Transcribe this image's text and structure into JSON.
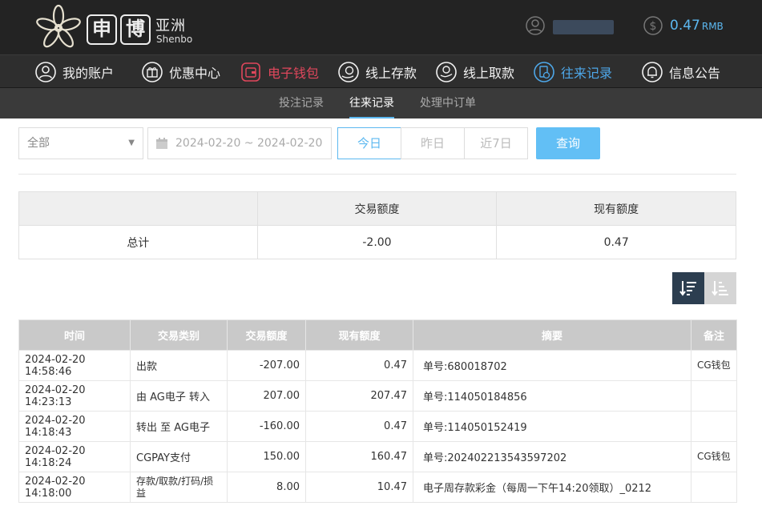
{
  "header": {
    "logo_char1": "申",
    "logo_char2": "博",
    "logo_cn": "亚洲",
    "logo_en": "Shenbo",
    "balance": "0.47",
    "balance_unit": "RMB"
  },
  "nav": {
    "items": [
      {
        "label": "我的账户"
      },
      {
        "label": "优惠中心"
      },
      {
        "label": "电子钱包"
      },
      {
        "label": "线上存款"
      },
      {
        "label": "线上取款"
      },
      {
        "label": "往来记录"
      },
      {
        "label": "信息公告"
      }
    ]
  },
  "subnav": {
    "items": [
      {
        "label": "投注记录"
      },
      {
        "label": "往来记录"
      },
      {
        "label": "处理中订单"
      }
    ]
  },
  "filters": {
    "type_selected": "全部",
    "date_range": "2024-02-20 ~ 2024-02-20",
    "today": "今日",
    "yesterday": "昨日",
    "last7": "近7日",
    "query": "查询"
  },
  "summary": {
    "col_trade": "交易额度",
    "col_current": "现有额度",
    "row_label": "总计",
    "trade_total": "-2.00",
    "current_total": "0.47"
  },
  "records": {
    "headers": [
      "时间",
      "交易类别",
      "交易额度",
      "现有额度",
      "摘要",
      "备注"
    ],
    "rows": [
      {
        "time": "2024-02-20 14:58:46",
        "type": "出款",
        "amount": "-207.00",
        "balance": "0.47",
        "summary": "单号:680018702",
        "note": "CG钱包"
      },
      {
        "time": "2024-02-20 14:23:13",
        "type": "由 AG电子 转入",
        "amount": "207.00",
        "balance": "207.47",
        "summary": "单号:114050184856",
        "note": ""
      },
      {
        "time": "2024-02-20 14:18:43",
        "type": "转出 至 AG电子",
        "amount": "-160.00",
        "balance": "0.47",
        "summary": "单号:114050152419",
        "note": ""
      },
      {
        "time": "2024-02-20 14:18:24",
        "type": "CGPAY支付",
        "amount": "150.00",
        "balance": "160.47",
        "summary": "单号:202402213543597202",
        "note": "CG钱包"
      },
      {
        "time": "2024-02-20 14:18:00",
        "type": "存款/取款/打码/损益",
        "amount": "8.00",
        "balance": "10.47",
        "summary": "电子周存款彩金（每周一下午14:20领取）_0212",
        "note": ""
      }
    ]
  },
  "colors": {
    "accent_blue": "#5cb8f0",
    "active_red": "#e0475c",
    "header_bg": "#232323"
  }
}
